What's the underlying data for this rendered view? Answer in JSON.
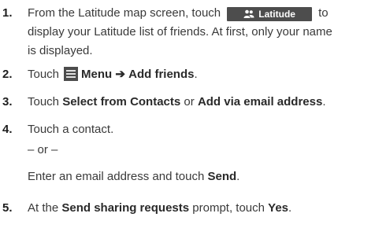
{
  "steps": [
    {
      "number": "1.",
      "line1_before": "From the Latitude map screen, touch",
      "button_label": "Latitude",
      "line1_after": "to",
      "line2": "display your Latitude list of friends. At first, only your name",
      "line3": "is displayed."
    },
    {
      "number": "2.",
      "before": "Touch",
      "menu_label": "Menu",
      "arrow": "➔",
      "action": "Add friends",
      "end": "."
    },
    {
      "number": "3.",
      "before": "Touch",
      "option1": "Select from Contacts",
      "middle": "or",
      "option2": "Add via email address",
      "end": "."
    },
    {
      "number": "4.",
      "line1": "Touch a contact.",
      "or": "– or –",
      "alt_before": "Enter an email address and touch",
      "alt_action": "Send",
      "end": "."
    },
    {
      "number": "5.",
      "before": "At the",
      "prompt": "Send sharing requests",
      "middle": "prompt, touch",
      "action": "Yes",
      "end": "."
    }
  ],
  "icons": {
    "latitude": "people-icon",
    "menu": "menu-icon"
  },
  "colors": {
    "button_bg": "#4d4d4d",
    "text": "#3a3a3a"
  }
}
